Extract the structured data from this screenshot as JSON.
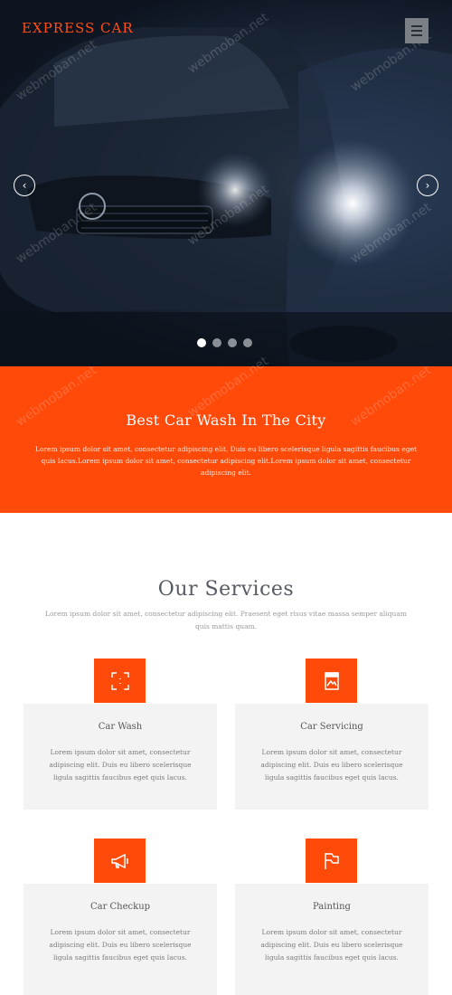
{
  "header": {
    "brand": "EXPRESS CAR"
  },
  "hero": {
    "prev_icon": "chevron-left",
    "next_icon": "chevron-right",
    "prev_glyph": "‹",
    "next_glyph": "›",
    "slides": 4,
    "active_slide": 1
  },
  "band": {
    "title": "Best Car Wash In The City",
    "text": "Lorem ipsum dolor sit amet, consectetur adipiscing elit. Duis eu libero scelerisque ligula sagittis faucibus eget quis lacus.Lorem ipsum dolor sit amet, consectetur adipiscing elit.Lorem ipsum dolor sit amet, consectetur adipiscing elit."
  },
  "services": {
    "title": "Our Services",
    "intro": "Lorem ipsum dolor sit amet, consectetur adipiscing elit. Praesent eget risus vitae massa semper aliquam quis mattis quam.",
    "items": [
      {
        "icon": "focus-frame-icon",
        "title": "Car Wash",
        "desc": "Lorem ipsum dolor sit amet, consectetur adipiscing elit. Duis eu libero scelerisque ligula sagittis faucibus eget quis lacus."
      },
      {
        "icon": "bookmark-image-icon",
        "title": "Car Servicing",
        "desc": "Lorem ipsum dolor sit amet, consectetur adipiscing elit. Duis eu libero scelerisque ligula sagittis faucibus eget quis lacus."
      },
      {
        "icon": "megaphone-icon",
        "title": "Car Checkup",
        "desc": "Lorem ipsum dolor sit amet, consectetur adipiscing elit. Duis eu libero scelerisque ligula sagittis faucibus eget quis lacus."
      },
      {
        "icon": "flag-icon",
        "title": "Painting",
        "desc": "Lorem ipsum dolor sit amet, consectetur adipiscing elit. Duis eu libero scelerisque ligula sagittis faucibus eget quis lacus."
      }
    ]
  },
  "colors": {
    "accent": "#ff4a0a",
    "card_bg": "#f3f3f3"
  },
  "watermark": "webmoban.net"
}
